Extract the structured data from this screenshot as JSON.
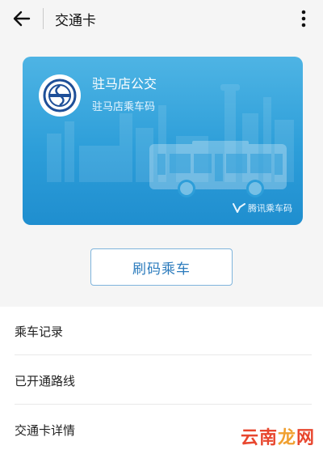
{
  "header": {
    "title": "交通卡"
  },
  "card": {
    "title": "驻马店公交",
    "subtitle": "驻马店乘车码",
    "brand": "腾讯乘车码",
    "colors": {
      "top": "#4eb4e4",
      "bottom": "#1f8ecf"
    }
  },
  "ride_button": {
    "label": "刷码乘车"
  },
  "menu": {
    "items": [
      {
        "label": "乘车记录"
      },
      {
        "label": "已开通路线"
      },
      {
        "label": "交通卡详情"
      }
    ]
  },
  "watermark": {
    "part1": "云南",
    "part2": "龙",
    "part3": "网"
  },
  "icons": [
    "back-arrow-icon",
    "more-vertical-icon",
    "bus-company-logo",
    "tencent-brand-icon"
  ]
}
